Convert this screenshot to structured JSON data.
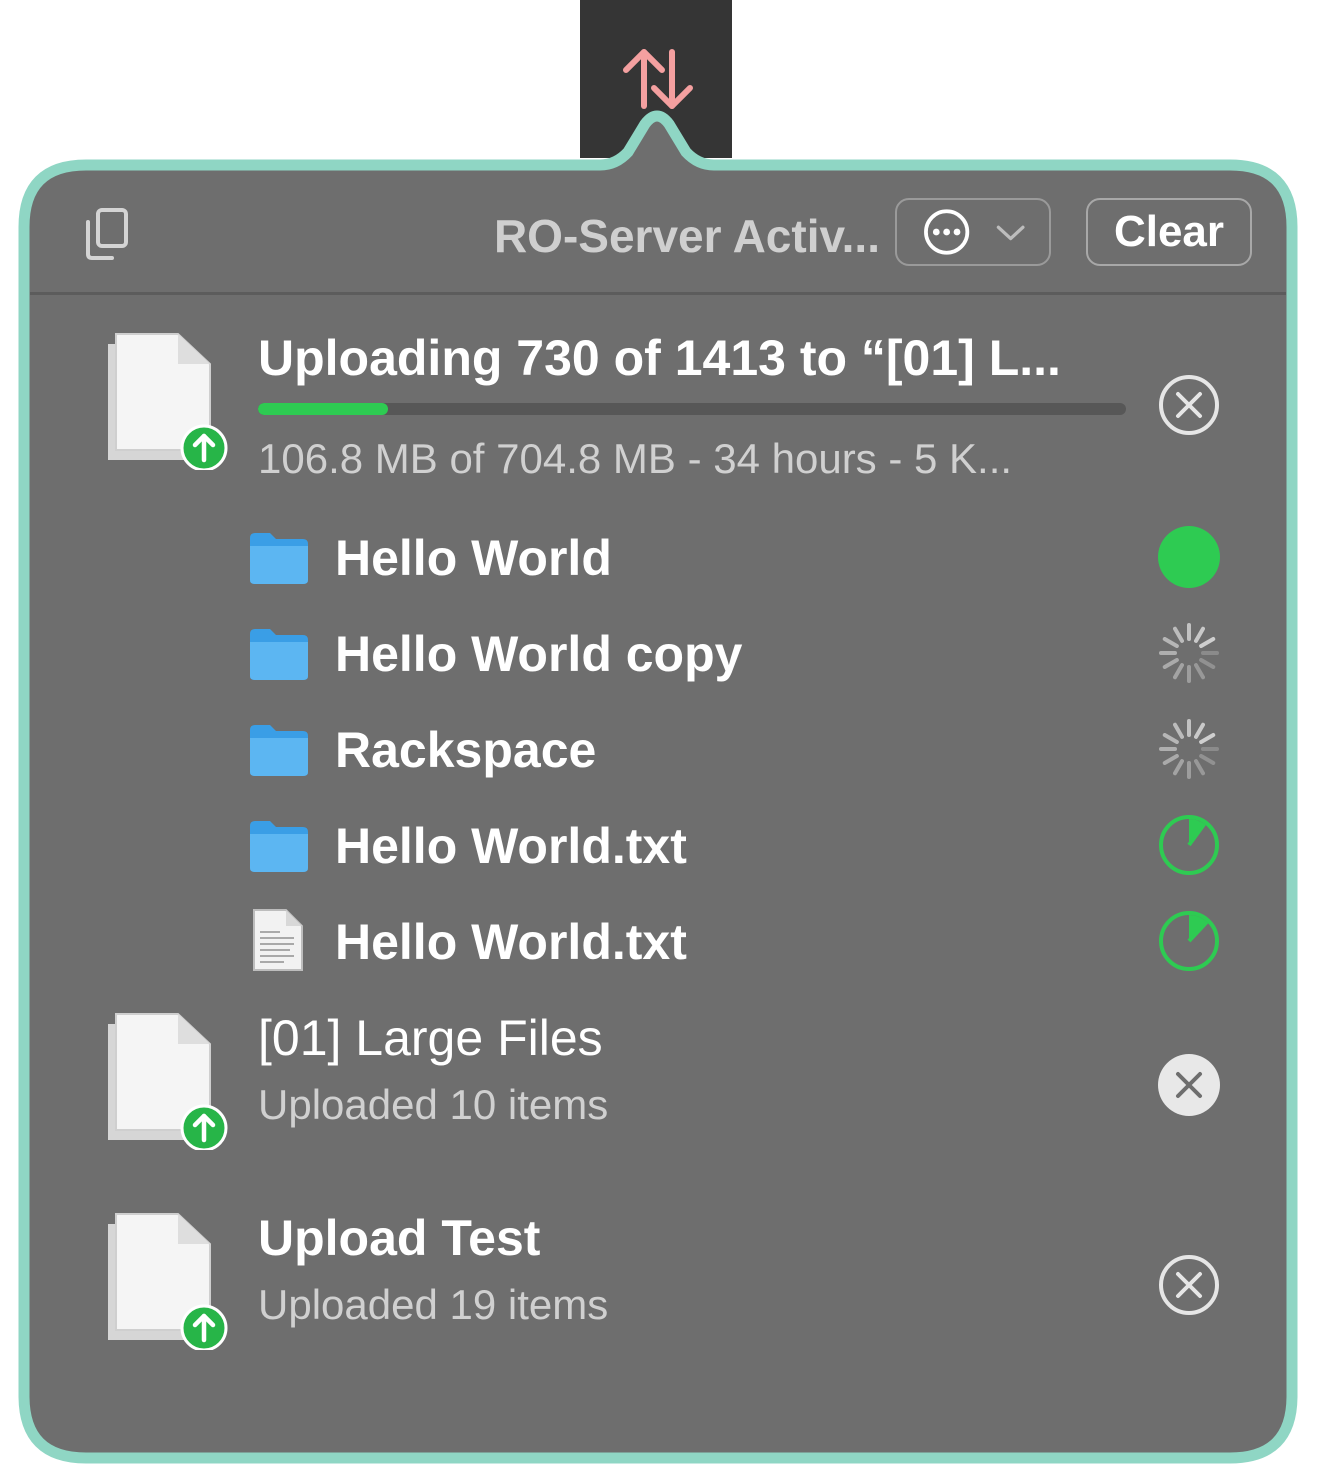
{
  "menubar": {
    "icon": "transfer-arrows-icon"
  },
  "popover": {
    "title": "RO-Server Activ...",
    "action_menu_icon": "ellipsis-circle-icon",
    "action_menu_chevron": "chevron-down-icon",
    "clear_label": "Clear"
  },
  "transfers": [
    {
      "title": "Uploading 730 of 1413 to “[01] L...",
      "detail": "106.8 MB of 704.8 MB - 34 hours - 5 K...",
      "progress": 0.15,
      "action": "stop",
      "items": [
        {
          "name": "Hello World",
          "kind": "folder",
          "status": "complete"
        },
        {
          "name": "Hello World copy",
          "kind": "folder",
          "status": "spinning"
        },
        {
          "name": "Rackspace",
          "kind": "folder",
          "status": "spinning"
        },
        {
          "name": "Hello World.txt",
          "kind": "folder",
          "status": "partial",
          "status_progress": 0.1
        },
        {
          "name": "Hello World.txt",
          "kind": "text-file",
          "status": "partial",
          "status_progress": 0.12
        }
      ]
    },
    {
      "title": "[01] Large Files",
      "detail": "Uploaded 10 items",
      "action": "remove-highlighted"
    },
    {
      "title": "Upload Test",
      "detail": "Uploaded 19 items",
      "action": "remove"
    }
  ],
  "colors": {
    "accent_border": "#8fd6c4",
    "panel_bg": "#6e6e6e",
    "progress_green": "#2ecb52",
    "arrow_pink": "#f4a0a0"
  }
}
